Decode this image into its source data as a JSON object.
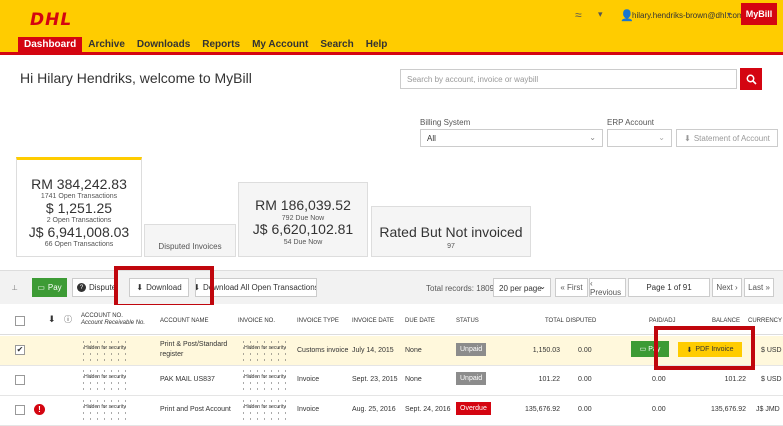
{
  "header": {
    "logo": "DHL",
    "user_email": "hilary.hendriks-brown@dhl.com",
    "mybill": "MyBill",
    "accent": "#ffcc00",
    "brand_red": "#d40511"
  },
  "nav": [
    "Dashboard",
    "Archive",
    "Downloads",
    "Reports",
    "My Account",
    "Search",
    "Help"
  ],
  "greeting": "Hi Hilary Hendriks, welcome to MyBill",
  "search": {
    "placeholder": "Search by account, invoice or waybill"
  },
  "filters": {
    "billing_label": "Billing System",
    "billing_value": "All",
    "erp_label": "ERP Account",
    "erp_value": "",
    "soa_label": "Statement of Account"
  },
  "summary": {
    "open": {
      "amt1": "RM 384,242.83",
      "sub1": "1741 Open Transactions",
      "amt2": "$ 1,251.25",
      "sub2": "2 Open Transactions",
      "amt3": "J$ 6,941,008.03",
      "sub3": "66 Open Transactions"
    },
    "disputed": {
      "label": "Disputed Invoices"
    },
    "due": {
      "amt1": "RM 186,039.52",
      "sub1": "792 Due Now",
      "amt2": "J$ 6,620,102.81",
      "sub2": "54 Due Now"
    },
    "rated": {
      "title": "Rated But Not invoiced",
      "count": "97"
    }
  },
  "toolbar": {
    "pay": "Pay",
    "dispute": "Dispute",
    "download": "Download",
    "download_all": "Download All Open Transactions",
    "total_records": "Total records: 1809",
    "per_page": "20 per page",
    "first": "« First",
    "previous": "‹ Previous",
    "page_info": "Page 1 of 91",
    "next": "Next ›",
    "last": "Last »"
  },
  "table": {
    "headers": {
      "account_no": "ACCOUNT NO.",
      "account_receivable": "Account Receivable No.",
      "account_name": "ACCOUNT NAME",
      "invoice_no": "INVOICE NO.",
      "invoice_type": "INVOICE TYPE",
      "invoice_date": "INVOICE DATE",
      "due_date": "DUE DATE",
      "status": "STATUS",
      "total": "TOTAL",
      "disputed": "DISPUTED",
      "paid_adj": "PAID/ADJ",
      "balance": "BALANCE",
      "currency": "CURRENCY"
    },
    "hidden_text": "Hidden for security",
    "rows": [
      {
        "account_name_l1": "Print & Post/Standard",
        "account_name_l2": "register",
        "invoice_type": "Customs invoice",
        "invoice_date": "July 14, 2015",
        "due_date": "None",
        "status": "Unpaid",
        "total": "1,150.03",
        "disputed": "0.00",
        "pay": "Pay",
        "pdf": "PDF Invoice",
        "currency": "$ USD"
      },
      {
        "account_name_l1": "PAK MAIL US837",
        "invoice_type": "Invoice",
        "invoice_date": "Sept. 23, 2015",
        "due_date": "None",
        "status": "Unpaid",
        "total": "101.22",
        "disputed": "0.00",
        "paid_adj": "0.00",
        "balance": "101.22",
        "currency": "$ USD"
      },
      {
        "account_name_l1": "Print and Post Account",
        "invoice_type": "Invoice",
        "invoice_date": "Aug. 25, 2016",
        "due_date": "Sept. 24, 2016",
        "status": "Overdue",
        "total": "135,676.92",
        "disputed": "0.00",
        "paid_adj": "0.00",
        "balance": "135,676.92",
        "currency": "J$ JMD"
      }
    ]
  }
}
